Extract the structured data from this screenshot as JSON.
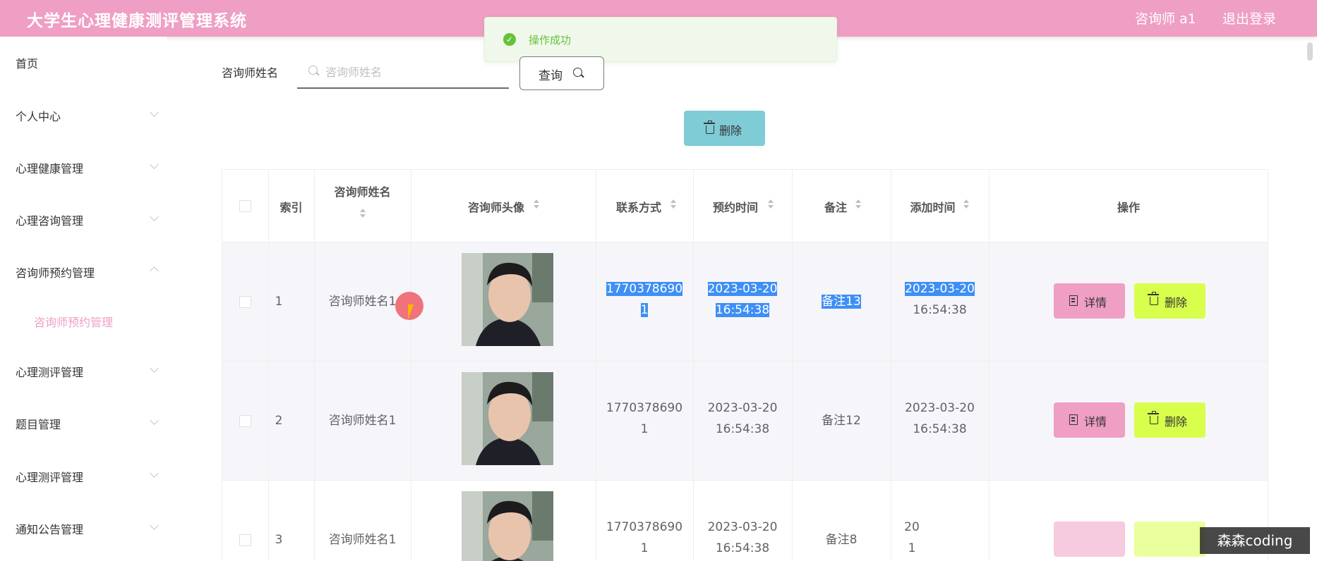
{
  "header": {
    "app_title": "大学生心理健康测评管理系统",
    "user": "咨询师 a1",
    "logout": "退出登录"
  },
  "toast": {
    "message": "操作成功"
  },
  "sidebar": {
    "items": [
      {
        "label": "首页"
      },
      {
        "label": "个人中心"
      },
      {
        "label": "心理健康管理"
      },
      {
        "label": "心理咨询管理"
      },
      {
        "label": "咨询师预约管理"
      },
      {
        "label": "咨询师预约管理"
      },
      {
        "label": "心理测评管理"
      },
      {
        "label": "题目管理"
      },
      {
        "label": "心理测评管理"
      },
      {
        "label": "通知公告管理"
      }
    ]
  },
  "search": {
    "label": "咨询师姓名",
    "placeholder": "咨询师姓名",
    "value": "",
    "query_button": "查询"
  },
  "toolbar": {
    "delete_button": "删除"
  },
  "table": {
    "headers": {
      "index": "索引",
      "name": "咨询师姓名",
      "avatar": "咨询师头像",
      "contact": "联系方式",
      "appointment_time": "预约时间",
      "remark": "备注",
      "added_time": "添加时间",
      "actions": "操作"
    },
    "rows": [
      {
        "index": "1",
        "name": "咨询师姓名1",
        "contact_1": "1770378690",
        "contact_2": "1",
        "appt_date": "2023-03-20",
        "appt_time": "16:54:38",
        "remark": "备注13",
        "added_date": "2023-03-20",
        "added_time": "16:54:38",
        "detail_button": "详情",
        "delete_button": "删除"
      },
      {
        "index": "2",
        "name": "咨询师姓名1",
        "contact_1": "1770378690",
        "contact_2": "1",
        "appt_date": "2023-03-20",
        "appt_time": "16:54:38",
        "remark": "备注12",
        "added_date": "2023-03-20",
        "added_time": "16:54:38",
        "detail_button": "详情",
        "delete_button": "删除"
      },
      {
        "index": "3",
        "name": "咨询师姓名1",
        "contact_1": "1770378690",
        "contact_2": "1",
        "appt_date": "2023-03-20",
        "appt_time": "16:54:38",
        "remark": "备注8",
        "added_date": "20",
        "added_time": "1",
        "detail_button": "",
        "delete_button": ""
      }
    ]
  },
  "watermark": "森森coding"
}
